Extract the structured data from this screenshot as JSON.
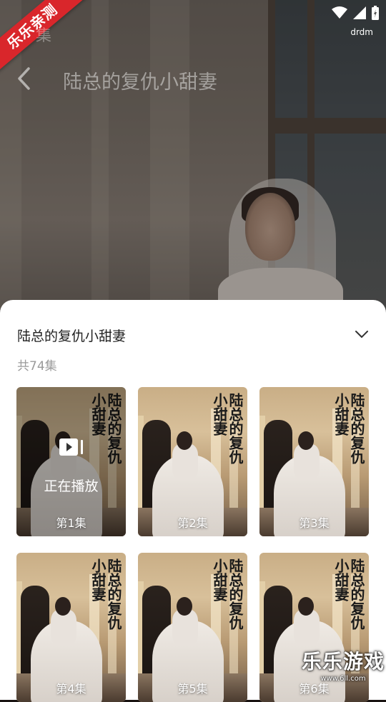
{
  "status_bar": {
    "carrier_label": "drdm"
  },
  "badge": {
    "text": "乐乐亲测"
  },
  "header": {
    "episode_label": "集",
    "title": "陆总的复仇小甜妻"
  },
  "sheet": {
    "title": "陆总的复仇小甜妻",
    "episode_count": "共74集",
    "now_playing": "正在播放",
    "cover_text": "陆总的复仇小甜妻",
    "episodes": [
      {
        "label": "第1集"
      },
      {
        "label": "第2集"
      },
      {
        "label": "第3集"
      },
      {
        "label": "第4集"
      },
      {
        "label": "第5集"
      },
      {
        "label": "第6集"
      }
    ]
  },
  "watermark": {
    "brand": "乐乐游戏",
    "url": "www.6ll.com"
  },
  "colors": {
    "badge": "#d9262b",
    "sheet_bg": "#ffffff",
    "muted_text": "#9a9a9a"
  }
}
